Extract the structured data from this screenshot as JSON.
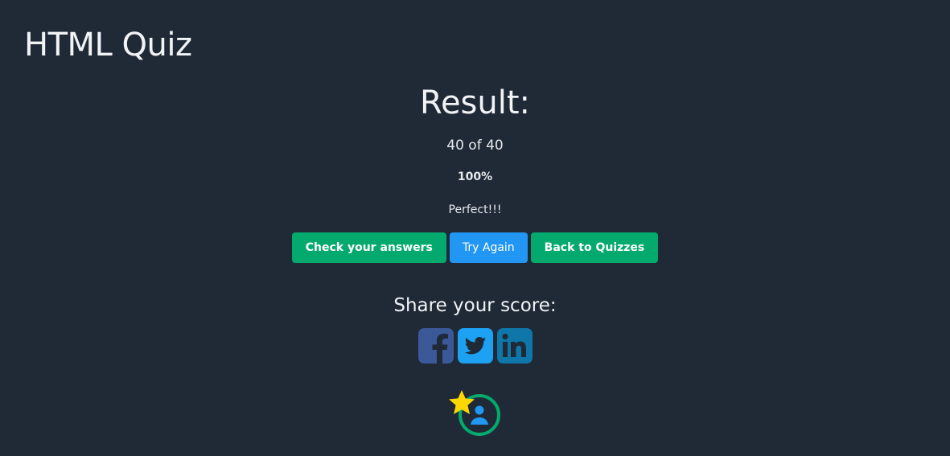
{
  "header": {
    "title": "HTML Quiz"
  },
  "result": {
    "heading": "Result:",
    "score": "40 of 40",
    "percent": "100%",
    "remark": "Perfect!!!"
  },
  "actions": {
    "check_answers_label": "Check your answers",
    "try_again_label": "Try Again",
    "back_label": "Back to Quizzes"
  },
  "share": {
    "heading": "Share your score:",
    "icons": [
      "facebook-icon",
      "twitter-icon",
      "linkedin-icon"
    ]
  },
  "badge": {
    "icons": [
      "star-icon",
      "profile-icon"
    ]
  },
  "colors": {
    "background": "#1f2a36",
    "green": "#04aa6d",
    "blue": "#2196f3",
    "facebook": "#3b5998",
    "twitter": "#1da1f2",
    "linkedin": "#0e76a8",
    "star": "#ffd700"
  }
}
